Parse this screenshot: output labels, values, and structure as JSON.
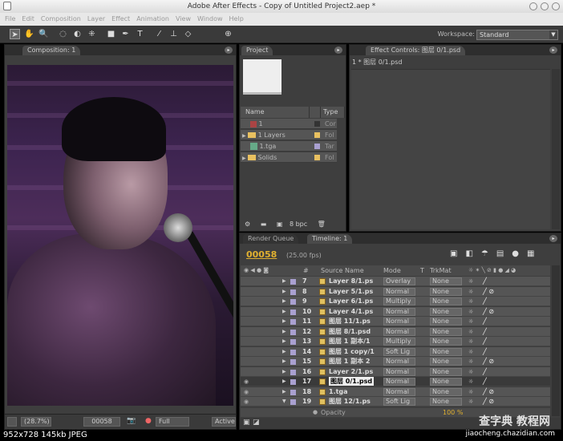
{
  "window": {
    "title": "Adobe After Effects - Copy of Untitled Project2.aep *"
  },
  "menu": [
    "File",
    "Edit",
    "Composition",
    "Layer",
    "Effect",
    "Animation",
    "View",
    "Window",
    "Help"
  ],
  "toolbar": {
    "tools": [
      "selection-tool",
      "hand-tool",
      "zoom-tool",
      "rotation-tool",
      "orbit-camera-tool",
      "pan-behind-tool",
      "rectangle-mask-tool",
      "pen-tool",
      "type-tool",
      "brush-tool",
      "clone-stamp-tool",
      "eraser-tool"
    ],
    "workspace_label": "Workspace:",
    "workspace_value": "Standard"
  },
  "composition": {
    "tab": "Composition: 1",
    "zoom": "(28.7%)",
    "timecode": "00058",
    "resolution": "Full",
    "camera": "Active"
  },
  "project": {
    "tab": "Project",
    "columns": [
      "Name",
      "Type"
    ],
    "items": [
      {
        "name": "1",
        "type": "Cor",
        "icon": "composition-icon",
        "label_color": "#333333"
      },
      {
        "name": "1 Layers",
        "type": "Fol",
        "icon": "folder-icon",
        "label_color": "#e8c060"
      },
      {
        "name": "1.tga",
        "type": "Tar",
        "icon": "footage-icon",
        "label_color": "#a9a0d0"
      },
      {
        "name": "Solids",
        "type": "Fol",
        "icon": "folder-icon",
        "label_color": "#e8c060"
      }
    ],
    "bpc": "8 bpc"
  },
  "effect_controls": {
    "tab": "Effect Controls: 图层 0/1.psd",
    "subtitle": "1 * 图层 0/1.psd"
  },
  "timeline": {
    "tab_render": "Render Queue",
    "tab": "Timeline: 1",
    "timecode": "00058",
    "fps": "(25.00 fps)",
    "columns": {
      "num": "#",
      "source": "Source Name",
      "mode": "Mode",
      "t": "T",
      "trkmat": "TrkMat"
    },
    "layers": [
      {
        "num": "7",
        "name": "Layer 8/1.ps",
        "mode": "Overlay",
        "trkmat": "None",
        "fx": false
      },
      {
        "num": "8",
        "name": "Layer 5/1.ps",
        "mode": "Normal",
        "trkmat": "None",
        "fx": true
      },
      {
        "num": "9",
        "name": "Layer 6/1.ps",
        "mode": "Multiply",
        "trkmat": "None",
        "fx": false
      },
      {
        "num": "10",
        "name": "Layer 4/1.ps",
        "mode": "Normal",
        "trkmat": "None",
        "fx": true
      },
      {
        "num": "11",
        "name": "图层 11/1.ps",
        "mode": "Normal",
        "trkmat": "None",
        "fx": false
      },
      {
        "num": "12",
        "name": "图层 8/1.psd",
        "mode": "Normal",
        "trkmat": "None",
        "fx": false
      },
      {
        "num": "13",
        "name": "图层 1 副本/1",
        "mode": "Multiply",
        "trkmat": "None",
        "fx": false
      },
      {
        "num": "14",
        "name": "图层 1 copy/1",
        "mode": "Soft Lig",
        "trkmat": "None",
        "fx": false
      },
      {
        "num": "15",
        "name": "图层 1 副本 2",
        "mode": "Normal",
        "trkmat": "None",
        "fx": true
      },
      {
        "num": "16",
        "name": "Layer 2/1.ps",
        "mode": "Normal",
        "trkmat": "None",
        "fx": false
      },
      {
        "num": "17",
        "name": "图层 0/1.psd",
        "mode": "Normal",
        "trkmat": "None",
        "fx": false,
        "selected": true,
        "visible": true
      },
      {
        "num": "18",
        "name": "1.tga",
        "mode": "Normal",
        "trkmat": "None",
        "fx": true,
        "visible": true
      },
      {
        "num": "19",
        "name": "图层 12/1.ps",
        "mode": "Soft Lig",
        "trkmat": "None",
        "fx": true,
        "visible": true,
        "expanded": true
      }
    ],
    "property": {
      "name": "Opacity",
      "value": "100 %"
    }
  },
  "status": {
    "info": "952x728  145kb  JPEG",
    "watermark": "jiaocheng.chazidian.com",
    "watermark_logo": "查字典 教程网"
  }
}
